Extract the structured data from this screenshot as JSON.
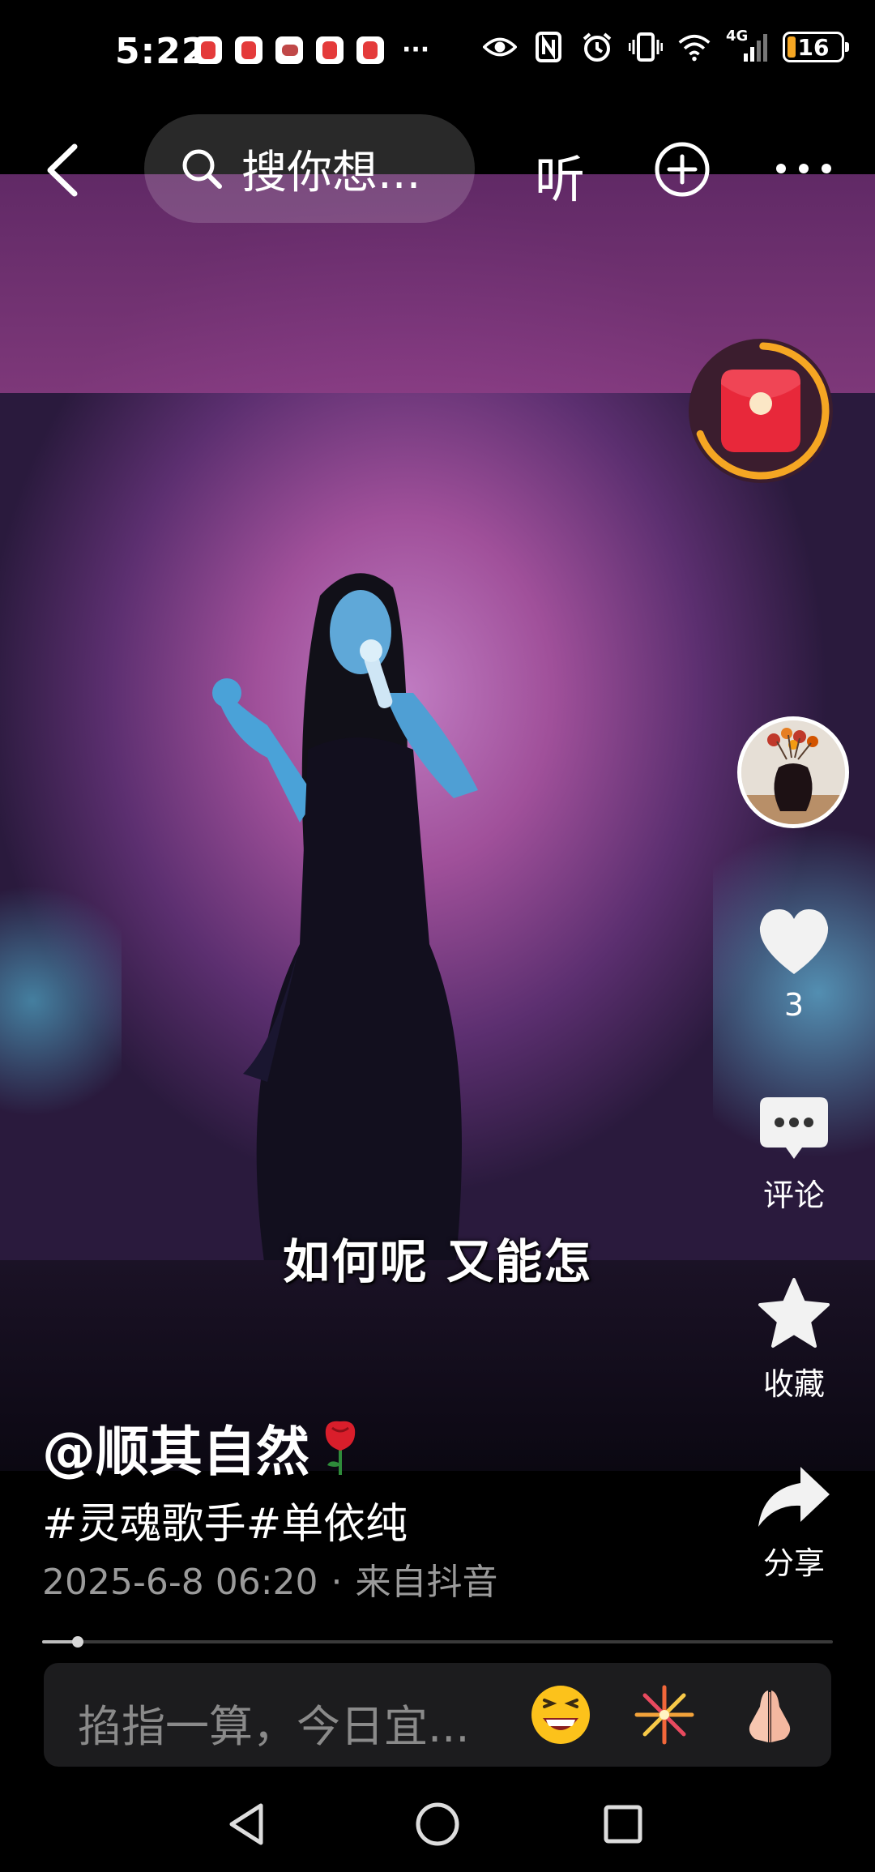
{
  "status_bar": {
    "time": "5:22",
    "more": "···",
    "network": "4G",
    "battery_level": "16",
    "battery_fraction": 0.16
  },
  "top_bar": {
    "search_placeholder": "搜你想...",
    "listen_label": "听"
  },
  "video": {
    "subtitle": "如何呢 又能怎"
  },
  "rail": {
    "like_count": "3",
    "comment_label": "评论",
    "favorite_label": "收藏",
    "share_label": "分享"
  },
  "post": {
    "author": "@顺其自然",
    "hashtags": "#灵魂歌手#单依纯",
    "date": "2025-6-8 06:20",
    "separator": "·",
    "source": "来自抖音"
  },
  "playback": {
    "progress_fraction": 0.045
  },
  "comment_input": {
    "placeholder": "掐指一算，今日宜..."
  },
  "colors": {
    "accent_orange": "#f5a623",
    "red_packet": "#e8283a",
    "stage_magenta": "#a0509a",
    "stage_cyan": "#5ad2f0"
  },
  "icons": [
    "back-arrow-icon",
    "search-icon",
    "plus-circle-icon",
    "more-dots-icon",
    "red-packet-icon",
    "heart-icon",
    "comment-bubble-icon",
    "star-icon",
    "share-arrow-icon",
    "rose-emoji-icon",
    "laughing-emoji-icon",
    "fireworks-emoji-icon",
    "praying-hands-emoji-icon",
    "nav-back-icon",
    "nav-home-icon",
    "nav-recents-icon"
  ]
}
